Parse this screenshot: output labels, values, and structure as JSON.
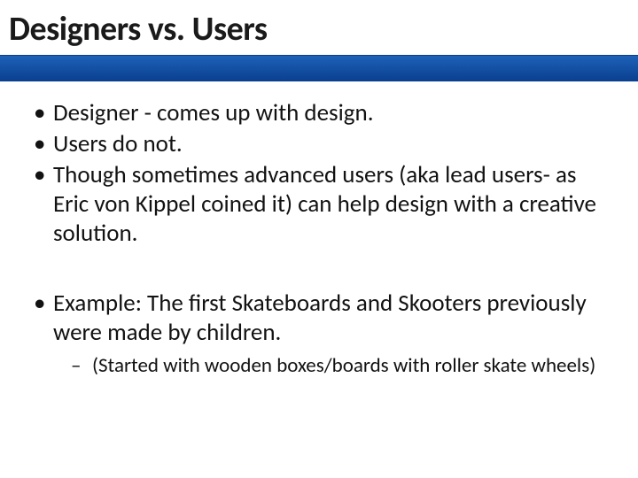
{
  "title": "Designers vs. Users",
  "bullets_group1": [
    "Designer  - comes up with design.",
    "Users do not.",
    "Though sometimes advanced users (aka lead users- as Eric von Kippel coined it) can help design with a creative solution."
  ],
  "bullets_group2": [
    "Example: The first Skateboards and Skooters previously were made by children."
  ],
  "subbullets_group2_0": [
    "(Started with wooden boxes/boards with roller skate wheels)"
  ]
}
